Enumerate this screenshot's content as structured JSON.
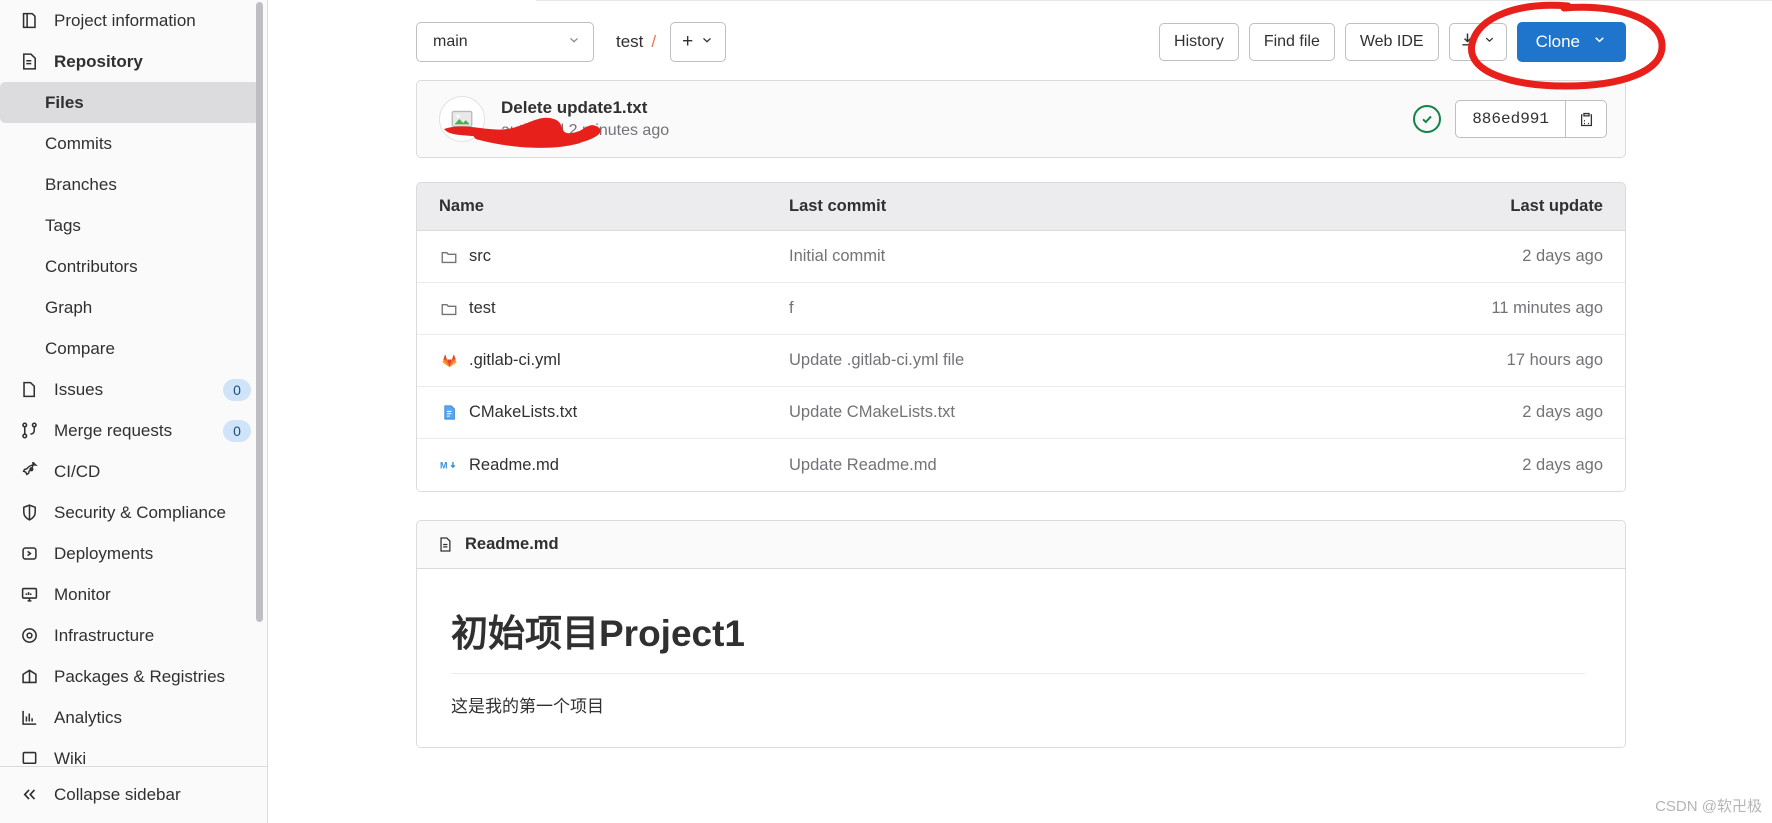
{
  "sidebar": {
    "items": [
      {
        "label": "Project information",
        "icon": "project-information-icon",
        "type": "top"
      },
      {
        "label": "Repository",
        "icon": "repository-icon",
        "type": "top-bold"
      },
      {
        "label": "Files",
        "icon": "",
        "type": "sub-active"
      },
      {
        "label": "Commits",
        "icon": "",
        "type": "sub"
      },
      {
        "label": "Branches",
        "icon": "",
        "type": "sub"
      },
      {
        "label": "Tags",
        "icon": "",
        "type": "sub"
      },
      {
        "label": "Contributors",
        "icon": "",
        "type": "sub"
      },
      {
        "label": "Graph",
        "icon": "",
        "type": "sub"
      },
      {
        "label": "Compare",
        "icon": "",
        "type": "sub"
      },
      {
        "label": "Issues",
        "icon": "issues-icon",
        "type": "top",
        "badge": "0"
      },
      {
        "label": "Merge requests",
        "icon": "merge-requests-icon",
        "type": "top",
        "badge": "0"
      },
      {
        "label": "CI/CD",
        "icon": "rocket-icon",
        "type": "top"
      },
      {
        "label": "Security & Compliance",
        "icon": "shield-icon",
        "type": "top"
      },
      {
        "label": "Deployments",
        "icon": "deployments-icon",
        "type": "top"
      },
      {
        "label": "Monitor",
        "icon": "monitor-icon",
        "type": "top"
      },
      {
        "label": "Infrastructure",
        "icon": "infrastructure-icon",
        "type": "top"
      },
      {
        "label": "Packages & Registries",
        "icon": "package-icon",
        "type": "top"
      },
      {
        "label": "Analytics",
        "icon": "analytics-icon",
        "type": "top"
      },
      {
        "label": "Wiki",
        "icon": "wiki-icon",
        "type": "top"
      }
    ],
    "collapse_label": "Collapse sidebar"
  },
  "toolbar": {
    "branch": "main",
    "breadcrumb_path": "test",
    "breadcrumb_separator": "/",
    "add_label": "+",
    "history_label": "History",
    "find_file_label": "Find file",
    "web_ide_label": "Web IDE",
    "clone_label": "Clone"
  },
  "commit": {
    "title": "Delete update1.txt",
    "meta": "authored 2 minutes ago",
    "sha": "886ed991",
    "pipeline_status": "passed"
  },
  "files": {
    "columns": {
      "name": "Name",
      "last_commit": "Last commit",
      "last_update": "Last update"
    },
    "rows": [
      {
        "name": "src",
        "icon": "folder-icon",
        "last_commit": "Initial commit",
        "last_update": "2 days ago"
      },
      {
        "name": "test",
        "icon": "folder-icon",
        "last_commit": "f",
        "last_update": "11 minutes ago"
      },
      {
        "name": ".gitlab-ci.yml",
        "icon": "gitlab-icon",
        "last_commit": "Update .gitlab-ci.yml file",
        "last_update": "17 hours ago"
      },
      {
        "name": "CMakeLists.txt",
        "icon": "text-file-icon",
        "last_commit": "Update CMakeLists.txt",
        "last_update": "2 days ago"
      },
      {
        "name": "Readme.md",
        "icon": "markdown-icon",
        "last_commit": "Update Readme.md",
        "last_update": "2 days ago"
      }
    ]
  },
  "readme": {
    "filename": "Readme.md",
    "heading": "初始项目Project1",
    "paragraph": "这是我的第一个项目"
  },
  "watermark": "CSDN @软卍极",
  "colors": {
    "accent": "#1f75cb",
    "annotation": "#e8201b",
    "success": "#108548",
    "badge_bg": "#cfe3f9",
    "sidebar_bg": "#fafafa",
    "active_bg": "#dcdcde"
  }
}
